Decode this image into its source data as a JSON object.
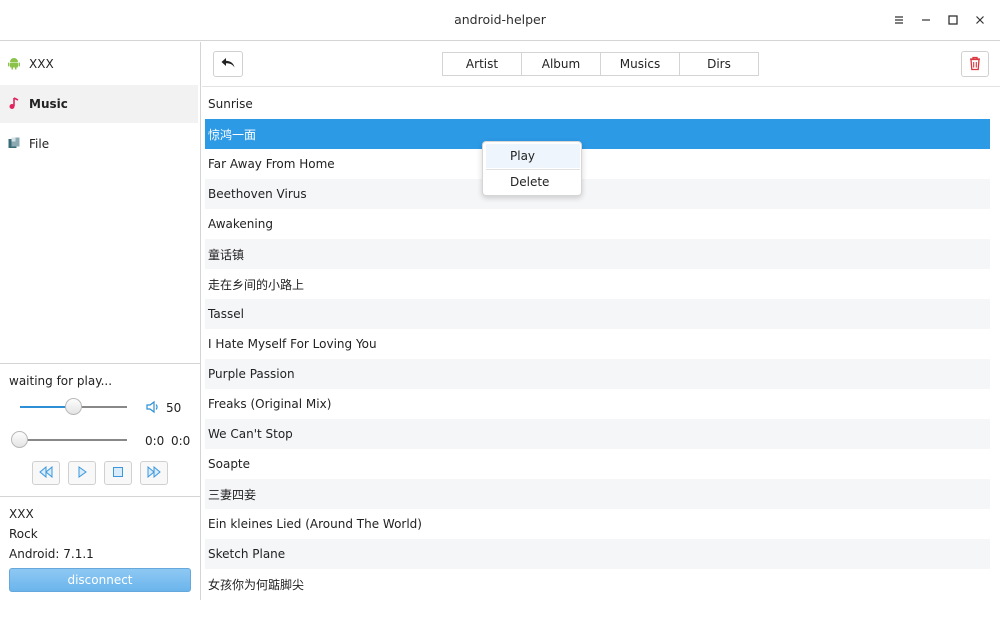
{
  "window": {
    "title": "android-helper"
  },
  "sidebar": {
    "items": [
      {
        "label": "XXX",
        "icon": "android-icon"
      },
      {
        "label": "Music",
        "icon": "music-note-icon",
        "active": true
      },
      {
        "label": "File",
        "icon": "file-icon"
      }
    ]
  },
  "player": {
    "status": "waiting for play...",
    "volume": 50,
    "volume_label": "50",
    "progress": 0,
    "elapsed": "0:0",
    "duration": "0:0"
  },
  "device": {
    "name": "XXX",
    "model": "Rock",
    "android": "Android: 7.1.1",
    "disconnect_label": "disconnect"
  },
  "toolbar": {
    "tabs": [
      "Artist",
      "Album",
      "Musics",
      "Dirs"
    ]
  },
  "songs": [
    "Sunrise",
    "惊鸿一面",
    "Far Away From Home",
    "Beethoven Virus",
    "Awakening",
    "童话镇",
    "走在乡间的小路上",
    "Tassel",
    "I Hate Myself For Loving You",
    "Purple Passion",
    "Freaks (Original Mix)",
    "We Can't Stop",
    "Soapte",
    "三妻四妾",
    "Ein kleines Lied (Around The World)",
    "Sketch Plane",
    "女孩你为何踮脚尖"
  ],
  "selected_song": "惊鸿一面",
  "context_menu": {
    "items": [
      "Play",
      "Delete"
    ]
  },
  "colors": {
    "accent": "#2d9ae6",
    "alt_row": "#f5f6f8"
  }
}
